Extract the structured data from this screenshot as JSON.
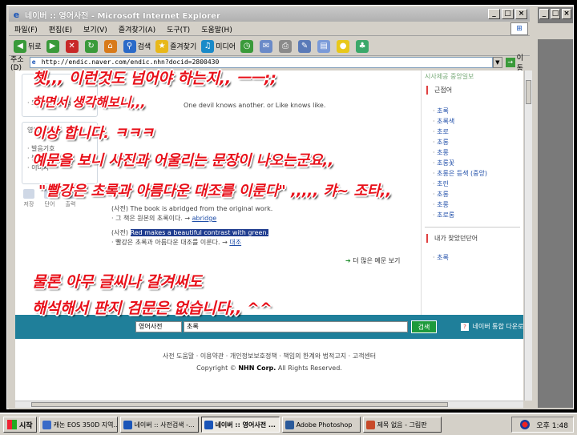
{
  "window": {
    "title": "네이버 :: 영어사전 - Microsoft Internet Explorer",
    "buttons": [
      "_",
      "□",
      "×"
    ]
  },
  "menu": {
    "items": [
      "파일(F)",
      "편집(E)",
      "보기(V)",
      "즐겨찾기(A)",
      "도구(T)",
      "도움말(H)"
    ]
  },
  "toolbar": {
    "back": "뒤로",
    "search": "검색",
    "favorites": "즐겨찾기",
    "media": "미디어"
  },
  "address": {
    "label": "주소(D)",
    "url": "http://endic.naver.com/endic.nhn?docid=2800430",
    "go": "이동"
  },
  "page": {
    "sample_sentence": "One devil knows another. or Like knows like.",
    "left_box_items": [
      "· 토익 Reading",
      "· 발음기호",
      "· 불규칙",
      "· 이미지"
    ],
    "left_section_label": "영어",
    "small_icons": [
      "저장",
      "단어",
      "출력"
    ],
    "example1_label": "(사전)",
    "example1_text": "The book is abridged from the original work.",
    "example1_trans": "· 그 책은 원본의 초록이다.",
    "example1_link": "abridge",
    "example2_label": "(사전)",
    "example2_text": "Red makes a beautiful contrast with green.",
    "example2_trans": "· 빨강은 초록과 아름다운 대조를 이룬다.",
    "example2_link": "대조",
    "more": "더 많은 예문 보기",
    "right_head": "시사제공 중앙일보",
    "related_title": "근접어",
    "related_words": [
      "초록",
      "초록색",
      "초로",
      "초롱",
      "초롱",
      "초롱꽃",
      "초롱은 등색 (중앙)",
      "초린",
      "초롱",
      "초롱",
      "초로롱"
    ],
    "recent_title": "내가 찾았던단어",
    "recent_words": [
      "초록"
    ],
    "search_select": "영어사전",
    "search_value": "초록",
    "search_button": "검색",
    "help_link": "네이버 통합 다운로드",
    "footer_links": "사전 도움말 · 이용약관 · 개인정보보호정책 · 책임의 한계와 법적고지 · 고객센터",
    "copyright_prefix": "Copyright ©",
    "copyright_brand": "NHN Corp.",
    "copyright_suffix": "All Rights Reserved."
  },
  "overlay": {
    "line1": "쳇,,, 이런것도 넘어야 하는지,, ㅡㅡ;;",
    "line2": "하면서 생각해보니,,,",
    "line3": "이상 합니다. ㅋㅋㅋ",
    "line4": "예문을 보니 사진과 어울리는 문장이 나오는군요,,",
    "line5": "\"빨강은 초록과 아름다운 대조를 이룬다\" ,,,,, 캬~ 조타,,",
    "line6": "물론 아무 글씨나 갈겨써도",
    "line7": "해석해서 판지 검문은 없습니다,, ^^"
  },
  "taskbar": {
    "start": "시작",
    "tasks": [
      {
        "label": "캐논 EOS 350D 지역...",
        "color": "#3a6bc8",
        "active": false
      },
      {
        "label": "네이버 :: 사전검색 -...",
        "color": "#1a55b8",
        "active": false
      },
      {
        "label": "네이버 :: 영어사전 ...",
        "color": "#1a55b8",
        "active": true
      },
      {
        "label": "Adobe Photoshop",
        "color": "#2a5a9a",
        "active": false
      },
      {
        "label": "제목 없음 - 그림판",
        "color": "#c84a2a",
        "active": false
      }
    ],
    "clock": "오후 1:48"
  }
}
